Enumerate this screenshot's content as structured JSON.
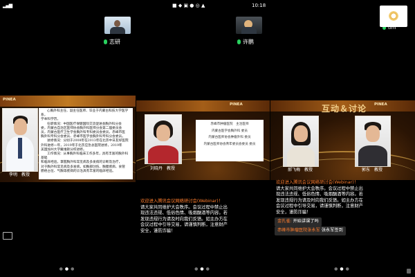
{
  "panels": [
    {
      "id": "p1",
      "participant_name": "志研",
      "slide": {
        "band_logo": "PINEA",
        "bio_lines": [
          "心胸外科主任、副主任医师、毕业于内蒙古科技大学医学系，",
          "学本科学历。",
          "任职情况：中国医疗保健国际交流促进会胸外科分会",
          "委，内蒙古自治区医师协会胸外科医师分会第二届委员会",
          "员，内蒙古医疗卫生学会胸外科专科委员会委员，赤峰市医",
          "胸外科专科分会委员、赤峰市医学会胸外科专科分会委员。",
          "进修情况：分别于2008年在2013年在北京中日友好医院",
          "外科进修一年，2019年于北京应急总医院进修，2019年",
          "美国加州大学戴维斯分校进修。",
          "工作情况：从事胸外科临床工作多年，具有丰富的胸外科基础",
          "和临床经验，掌握胸外科常见病及多发病的诊断及治疗，",
          "对于胸外科常见病及多发病，如胸部创伤、胸膜疾病、食管",
          "肠癌占位、气胸等疾病的诊治具有丰富的临床经验。"
        ],
        "caption": "李明　教授"
      }
    },
    {
      "id": "p2",
      "participant_name": "许鹏",
      "status_time": "10:18",
      "slide": {
        "band_logo": "PINEA",
        "box_lines": [
          "赤峰市肿瘤医院　主治医师",
          "内蒙古医学会胸外科 委员",
          "内蒙古医师协会肿瘤外科 委员",
          "内蒙古医师协会青年委员会委员 委员"
        ],
        "caption": "刘晓丹　教授"
      },
      "chat_lines": [
        "欢迎进入腾讯会议网络研讨会(Webinar)！",
        "请大家共同维护大会秩序。会议过程中禁止出",
        "现违法违规、低俗色情、吸烟酗酒等内容。若",
        "发现违规行为请及时向我们反馈。如主办方在",
        "会议过程中引导交易，请谨慎判断，注意财产",
        "安全，谨防诈骗！"
      ]
    },
    {
      "id": "p3",
      "participant_name": "tim",
      "slide": {
        "title": "互动＆讨论",
        "band_logo": "PINEA",
        "caption_left": "郝飞梅　教授",
        "caption_right": "郭东　教授"
      },
      "chat_lines": [
        "欢迎进入腾讯会议网络研讨会(Webinar)！",
        "请大家共同维护大会秩序。会议过程中禁止出",
        "现违法违规、低俗色情、吸烟酗酒等内容。若",
        "发现违规行为请及时向我们反馈。如主办方在",
        "会议过程中引导交易，请谨慎判断，注意财产",
        "安全，谨防诈骗！"
      ],
      "messages": [
        {
          "sender": "金孔雀:",
          "text": "开始讲课了吗"
        },
        {
          "sender": "赤峰市肿瘤医院张永军",
          "text": "张永军签到"
        }
      ]
    }
  ],
  "colors": {
    "mic_active": "#29d05e",
    "chat_highlight": "#ff7e2e",
    "slide_band": "#c07a22",
    "slide_title": "#f2d08c"
  },
  "icons": [
    "mic-icon",
    "signal-icon",
    "battery-icon",
    "flower-avatar-icon",
    "picture-in-picture-icon",
    "lock-icon"
  ],
  "page_indicator": {
    "count": 3,
    "active": 1
  }
}
